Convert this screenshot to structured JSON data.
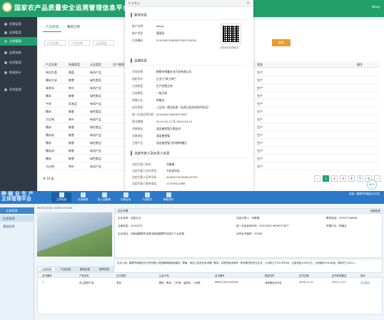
{
  "app": {
    "title": "国家农产品质量安全追溯管理信息平台",
    "top_right": "Wong"
  },
  "sidebar": {
    "items": [
      {
        "label": "质量监管"
      },
      {
        "label": "追溯管理"
      },
      {
        "label": "主体管理"
      },
      {
        "label": "监督抽查"
      },
      {
        "label": "检测管理"
      },
      {
        "label": "数据统计"
      },
      {
        "label": "系统管理"
      }
    ]
  },
  "content": {
    "tabs": [
      {
        "label": "产品管理"
      },
      {
        "label": "我的订单"
      }
    ],
    "filters": [
      {
        "placeholder": "产品名称"
      },
      {
        "placeholder": "产品名称"
      },
      {
        "placeholder": "认证类型"
      }
    ],
    "query_label": "查询",
    "columns": [
      "产品名称",
      "所属类型",
      "认证类型",
      "生产基地",
      "状态",
      "操作"
    ],
    "rows": [
      {
        "name": "有机生菜",
        "type": "蔬菜",
        "cert": "有机产品",
        "status": "生产"
      },
      {
        "name": "糯米大米",
        "type": "粮食",
        "cert": "绿色食品",
        "status": "生产"
      },
      {
        "name": "青茶米",
        "type": "茶叶",
        "cert": "有机产品",
        "status": "生产"
      },
      {
        "name": "糯米",
        "type": "粮食",
        "cert": "绿色食品",
        "status": "生产"
      },
      {
        "name": "牛奶",
        "type": "乳制品",
        "cert": "有机产品",
        "status": "生产"
      },
      {
        "name": "糯米",
        "type": "粮食",
        "cert": "绿色食品",
        "status": "生产"
      },
      {
        "name": "大红袍",
        "type": "茶叶",
        "cert": "有机产品",
        "status": "生产"
      },
      {
        "name": "糯米",
        "type": "粮食",
        "cert": "绿色食品",
        "status": "生产"
      },
      {
        "name": "糯米米",
        "type": "粮食",
        "cert": "有机产品",
        "status": "生产"
      },
      {
        "name": "糯米",
        "type": "粮食",
        "cert": "绿色食品",
        "status": "生产"
      },
      {
        "name": "糯米米",
        "type": "粮食",
        "cert": "有机产品",
        "status": "生产"
      },
      {
        "name": "糯米",
        "type": "粮食",
        "cert": "绿色食品",
        "status": "生产"
      },
      {
        "name": "大红袍",
        "type": "茶叶",
        "cert": "有机产品",
        "status": "生产"
      }
    ],
    "pager": {
      "total": "共 10 条",
      "pages": [
        "1",
        "2",
        "3",
        "4",
        "5",
        "6"
      ],
      "current": "1"
    }
  },
  "modal": {
    "title": "个人中心",
    "account_section": "账号信息",
    "account": [
      {
        "k": "账户名称",
        "v": "Wong"
      },
      {
        "k": "账户类型",
        "v": "管理员"
      },
      {
        "k": "主体编码",
        "v": "91410621063815784T-00001"
      }
    ],
    "qr_caption": "扫码登录追溯系统",
    "register_section": "注册信息",
    "register": [
      {
        "k": "主体名称",
        "v": "鹤壁市明鑫农业开发有限公司"
      },
      {
        "k": "组织形式",
        "v": "企业/个体工商户"
      },
      {
        "k": "主体类型",
        "v": "生产经营主体"
      },
      {
        "k": "主体属性",
        "v": "一般主体"
      },
      {
        "k": "所属行业",
        "v": "种植业"
      },
      {
        "k": "证件类型",
        "v": "三证合一营业执照（无独立组织机构代码证）"
      },
      {
        "k": "统一社会信用代码",
        "v": "91410621063815784T"
      },
      {
        "k": "营业期限",
        "v": "2013-03-13 至 2023-03-12"
      },
      {
        "k": "详细地址",
        "v": "浚县善堂镇大赉店村"
      },
      {
        "k": "注册地址",
        "v": "浚县善堂镇"
      },
      {
        "k": "主营产品",
        "v": "浚县善堂镇 农作物种植业"
      }
    ],
    "legal_section": "法定代表人及负责人信息",
    "legal": [
      {
        "k": "法定代表人姓名",
        "v": "刘琳璞"
      },
      {
        "k": "法定代表人证件类型",
        "v": "大陆身份证"
      },
      {
        "k": "法定代表人证件号码",
        "v": "410621197008142334"
      },
      {
        "k": "法定代表人联系电话",
        "v": "17703921989"
      }
    ]
  },
  "bottom": {
    "logo_line1": "种 植 业 生 产",
    "logo_line2": "主体管理平台",
    "nav": [
      {
        "label": "主体信息"
      },
      {
        "label": "农资管理"
      },
      {
        "label": "投入品管理"
      },
      {
        "label": "农事活动"
      },
      {
        "label": "产品批次"
      },
      {
        "label": "基础资料"
      }
    ],
    "user": "欢迎！鹤壁市明鑫农业开发",
    "side_header": "主体信息",
    "side_items": [
      {
        "label": "信息管理"
      },
      {
        "label": "基础信息"
      }
    ],
    "image_caption": "9010104100-103000-9-0046",
    "info_bar": "企业详情",
    "info_button": "详细信息",
    "info": [
      {
        "k": "企业名称：",
        "v": "浚县企业"
      },
      {
        "k": "法定代表人：",
        "v": "刘琳璞"
      },
      {
        "k": "联系电话：",
        "v": "03925726888"
      },
      {
        "k": "注册资金：",
        "v": "1000万元"
      },
      {
        "k": "统一社会信用代码：",
        "v": "91410621063815784T"
      },
      {
        "k": "所属行业：",
        "v": "种植业"
      },
      {
        "k": "企业地址：",
        "v": "河南省鹤壁市浚县河南省鹤壁市浚县571乡浚镇"
      },
      {
        "k": "合作证书面积：",
        "v": "20408"
      }
    ],
    "intro": "企业介绍：鹤壁市明鑫农业开发有限公司是集种植基地建设、种植、深加工及农业技术推广服务，并提供技术指导一体化模式的农业企业。公司成立于2013年3月，注册资金1000万元，占地面积1000余亩，拥有员工200人。",
    "tabs": [
      {
        "label": "认证信息"
      },
      {
        "label": "产品信息"
      },
      {
        "label": "基地信息"
      },
      {
        "label": "荣誉资质"
      }
    ],
    "table_columns": [
      "证书编号",
      "产品名称",
      "证书类型",
      "认证产品",
      "证书编号",
      "颁证机构",
      "证书日期",
      "证书有效期至",
      "操作"
    ],
    "table_rows": [
      {
        "no": "1",
        "product": "东山麦类产品",
        "ctype": "有机",
        "scope": "糯米、黑米、三叶草、油菜花、小米等",
        "code": "WNCS-HA15-00034",
        "org": "河南豫农合作社",
        "date": "2018-11-22",
        "expire": "2021-11-21",
        "op": "点击显示"
      }
    ],
    "badge": "60%"
  }
}
